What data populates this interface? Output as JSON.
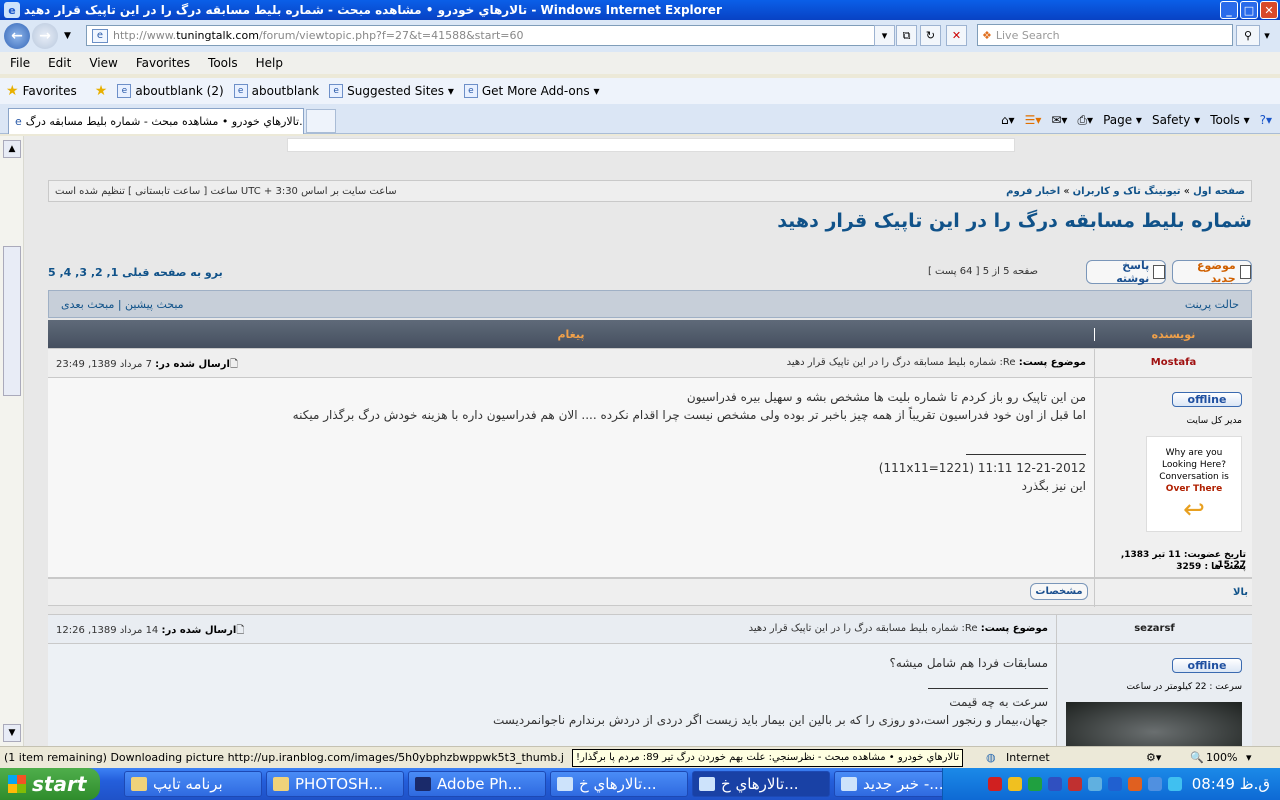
{
  "window": {
    "title": "تالارهاي خودرو • مشاهده مبحث - شماره بلیط مسابقه درگ را در این تاپیک قرار دهید - Windows Internet Explorer"
  },
  "address": {
    "prefix": "http://www.",
    "host": "tuningtalk.com",
    "path": "/forum/viewtopic.php?f=27&t=41588&start=60",
    "search_placeholder": "Live Search"
  },
  "menu": [
    "File",
    "Edit",
    "View",
    "Favorites",
    "Tools",
    "Help"
  ],
  "favorites": {
    "label": "Favorites",
    "items": [
      "aboutblank (2)",
      "aboutblank",
      "Suggested Sites ▾",
      "Get More Add-ons ▾"
    ]
  },
  "tab": {
    "title": "تالارهاي خودرو • مشاهده مبحث - شماره بلیط مسابقه درگ..."
  },
  "commands": [
    "Page ▾",
    "Safety ▾",
    "Tools ▾"
  ],
  "forum": {
    "breadcrumb": [
      "صفحه اول",
      "تیونینگ تاک و کاربران",
      "اخبار فروم"
    ],
    "timezone": "ساعت سایت بر اساس UTC + 3:30 ساعت [ ساعت تابستانی ] تنظیم شده است",
    "topic_title": "شماره بلیط مسابقه درگ را در این تاپیک قرار دهید",
    "new_topic": "موضوع جدید",
    "reply": "پاسخ نوشته",
    "page_info": "صفحه 5 از 5 [ 64 پست ]",
    "page_links": "برو به صفحه قبلی 1, 2, 3, 4, 5",
    "print_view": "حالت پرینت",
    "prev_next": "مبحث پیشین | مبحث بعدی",
    "col_author": "نویسنده",
    "col_message": "پیغام",
    "post1": {
      "author": "Mostafa",
      "subject_label": "موضوع پست:",
      "subject": "Re: شماره بلیط مسابقه درگ را در این تاپیک قرار دهید",
      "date_label": "ارسال شده در:",
      "date": "7 مرداد 1389, 23:49",
      "status": "offline",
      "rank": "مدیر کل سایت",
      "avatar_line1": "Why are you",
      "avatar_line2": "Looking Here?",
      "avatar_line3": "Conversation is",
      "avatar_line4": "Over There",
      "joined": "تاریخ عضویت: 11 تیر 1383, 15:27",
      "posts": "پست ها : 3259",
      "line1": "من این تاپیک رو باز کردم تا شماره بلیت ها مشخص بشه و سهیل بیره فدراسیون",
      "line2": "اما قبل از اون خود فدراسیون تقریباً از همه چیز باخبر تر بوده ولی مشخص نیست چرا اقدام نکرده .... الان هم فدراسیون داره با هزینه خودش درگ برگذار میکنه",
      "sig1": "12-21-2012 11:11 (111x11=1221)",
      "sig2": "این نیز بگذرد",
      "top": "بالا",
      "profile": "مشخصات"
    },
    "post2": {
      "author": "sezarsf",
      "subject_label": "موضوع پست:",
      "subject": "Re: شماره بلیط مسابقه درگ را در این تاپیک قرار دهید",
      "date_label": "ارسال شده در:",
      "date": "14 مرداد 1389, 12:26",
      "status": "offline",
      "rank": "سرعت : 22 کیلومتر در ساعت",
      "line1": "مسابقات فردا هم شامل میشه؟",
      "sig1": "سرعت به چه قیمت",
      "sig2": "جهان،بیمار و رنجور است،دو روزی را که بر بالین این بیمار باید زیست اگر دردی از دردش برندارم ناجوانمردیست"
    }
  },
  "status": {
    "text": "(1 item remaining) Downloading picture http://up.iranblog.com/images/5h0ybphzbwppwk5t3_thumb.jpg...",
    "zone": "Internet",
    "zoom": "100%",
    "tooltip": "تالارهاي خودرو • مشاهده مبحث - نظرسنجي: علت بهم خوردن درگ تیر 89: مردم پا برگذار!"
  },
  "taskbar": {
    "start": "start",
    "items": [
      "برنامه تایپ",
      "PHOTOSH...",
      "Adobe Ph...",
      "تالارهاي خ...",
      "تالارهاي خ...",
      "خبر جدید -..."
    ],
    "clock": "ق.ظ 08:49"
  }
}
